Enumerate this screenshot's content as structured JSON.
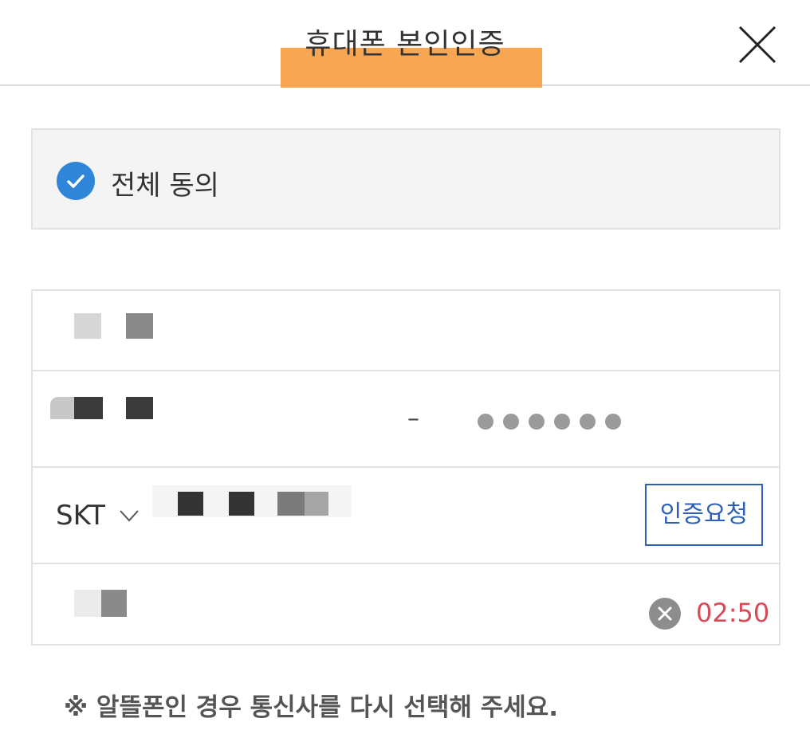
{
  "header": {
    "title": "휴대폰 본인인증",
    "close_icon": "close-icon"
  },
  "agreement": {
    "label": "전체 동의",
    "checked": true,
    "icon": "checkmark-circle-icon",
    "check_color": "#2f86d9"
  },
  "form": {
    "birth_masked": "••••••",
    "carrier": "SKT",
    "carrier_icon": "chevron-down-icon",
    "request_button": "인증요청",
    "timer": "02:50",
    "clear_icon": "clear-icon"
  },
  "notice": "※ 알뜰폰인 경우 통신사를 다시 선택해 주세요.",
  "colors": {
    "accent_blue": "#2d61b7",
    "timer_red": "#d84a55",
    "highlight_orange": "#f7a24b"
  }
}
